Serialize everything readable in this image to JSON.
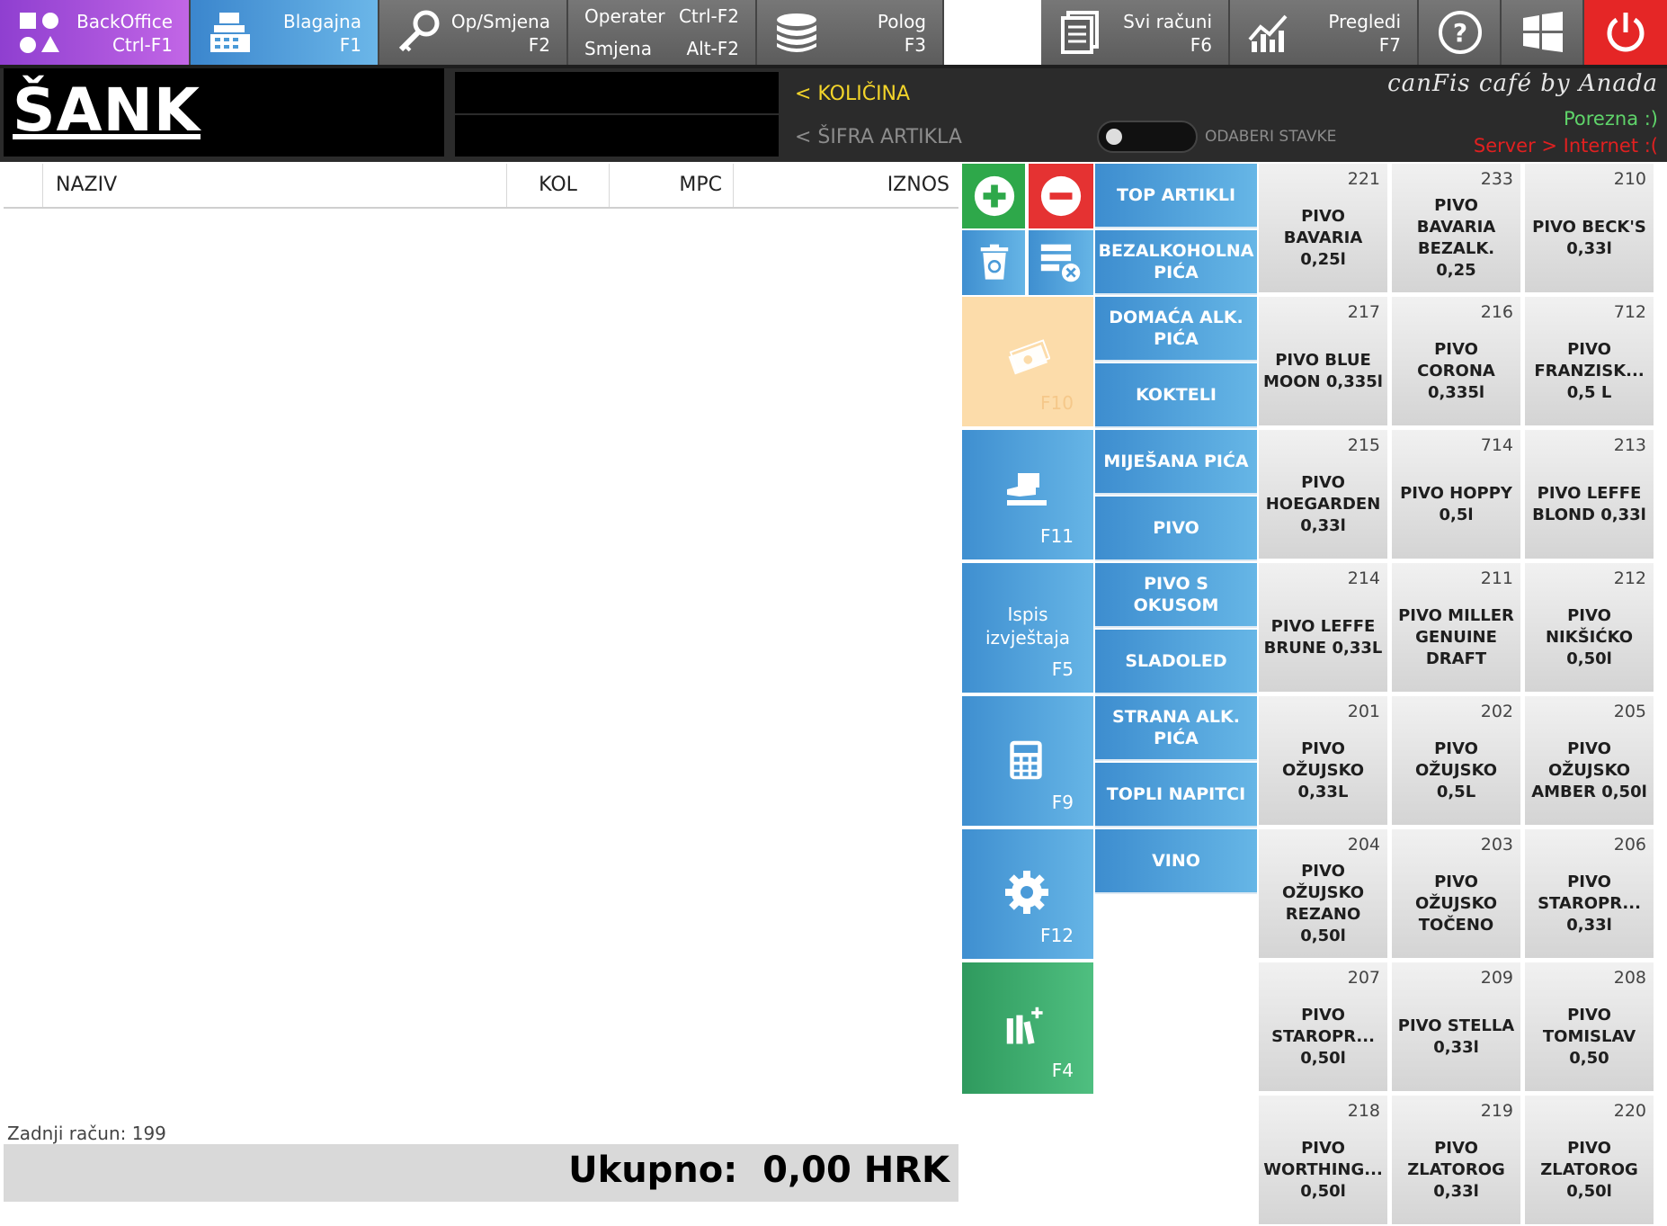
{
  "toolbar": {
    "backoffice": {
      "l1": "BackOffice",
      "l2": "Ctrl-F1",
      "icon": "shapes-icon"
    },
    "blagajna": {
      "l1": "Blagajna",
      "l2": "F1",
      "icon": "cash-register-icon"
    },
    "opsmjena": {
      "l1": "Op/Smjena",
      "l2": "F2",
      "icon": "key-icon"
    },
    "operater": {
      "l1a": "Operater",
      "l1b": "Ctrl-F2",
      "l2a": "Smjena",
      "l2b": "Alt-F2"
    },
    "polog": {
      "l1": "Polog",
      "l2": "F3",
      "icon": "coins-stack-icon"
    },
    "svi_racuni": {
      "l1": "Svi računi",
      "l2": "F6",
      "icon": "receipts-icon"
    },
    "pregledi": {
      "l1": "Pregledi",
      "l2": "F7",
      "icon": "chart-icon"
    }
  },
  "header": {
    "title": "ŠANK",
    "kolicina_label": "< KOLIČINA",
    "sifra_label": "< ŠIFRA ARTIKLA",
    "odaberi_label": "ODABERI STAVKE",
    "brand": "canFis café by Anada",
    "porezna": "Porezna :)",
    "server": "Server > Internet :("
  },
  "receipt": {
    "columns": [
      "NAZIV",
      "KOL",
      "MPC",
      "IZNOS"
    ],
    "last_receipt": "Zadnji račun: 199",
    "total": "Ukupno:  0,00 HRK"
  },
  "actions": {
    "payment_key": "F10",
    "card_key": "F11",
    "report_label": "Ispis izvještaja",
    "report_key": "F5",
    "calc_key": "F9",
    "settings_key": "F12",
    "f4_key": "F4"
  },
  "categories": [
    "TOP ARTIKLI",
    "BEZALKOHOLNA PIĆA",
    "DOMAĆA ALK. PIĆA",
    "KOKTELI",
    "MIJEŠANA PIĆA",
    "PIVO",
    "PIVO S OKUSOM",
    "SLADOLED",
    "STRANA ALK. PIĆA",
    "TOPLI NAPITCI",
    "VINO"
  ],
  "products": [
    {
      "code": "221",
      "name": "PIVO BAVARIA 0,25l"
    },
    {
      "code": "233",
      "name": "PIVO BAVARIA BEZALK. 0,25"
    },
    {
      "code": "210",
      "name": "PIVO BECK'S 0,33l"
    },
    {
      "code": "217",
      "name": "PIVO BLUE MOON 0,335l"
    },
    {
      "code": "216",
      "name": "PIVO CORONA 0,335l"
    },
    {
      "code": "712",
      "name": "PIVO FRANZISK... 0,5 L"
    },
    {
      "code": "215",
      "name": "PIVO HOEGARDEN 0,33l"
    },
    {
      "code": "714",
      "name": "PIVO HOPPY 0,5l"
    },
    {
      "code": "213",
      "name": "PIVO LEFFE BLOND 0,33l"
    },
    {
      "code": "214",
      "name": "PIVO LEFFE BRUNE 0,33L"
    },
    {
      "code": "211",
      "name": "PIVO MILLER GENUINE DRAFT"
    },
    {
      "code": "212",
      "name": "PIVO NIKŠIĆKO 0,50l"
    },
    {
      "code": "201",
      "name": "PIVO OŽUJSKO 0,33L"
    },
    {
      "code": "202",
      "name": "PIVO OŽUJSKO 0,5L"
    },
    {
      "code": "205",
      "name": "PIVO OŽUJSKO AMBER 0,50l"
    },
    {
      "code": "204",
      "name": "PIVO OŽUJSKO REZANO 0,50l"
    },
    {
      "code": "203",
      "name": "PIVO OŽUJSKO TOČENO"
    },
    {
      "code": "206",
      "name": "PIVO STAROPR... 0,33l"
    },
    {
      "code": "207",
      "name": "PIVO STAROPR... 0,50l"
    },
    {
      "code": "209",
      "name": "PIVO STELLA 0,33l"
    },
    {
      "code": "208",
      "name": "PIVO TOMISLAV 0,50"
    },
    {
      "code": "218",
      "name": "PIVO WORTHING... 0,50l"
    },
    {
      "code": "219",
      "name": "PIVO ZLATOROG 0,33l"
    },
    {
      "code": "220",
      "name": "PIVO ZLATOROG 0,50l"
    }
  ],
  "colors": {
    "backoffice": "#a04fd8",
    "blagajna": "#4a9ad8",
    "power": "#e52626",
    "header": "#2b2b2b",
    "category": "#4f9fdc",
    "payment": "#fcdcaa",
    "green": "#3aa86a",
    "plus": "#2ea84a",
    "minus": "#e53232"
  }
}
